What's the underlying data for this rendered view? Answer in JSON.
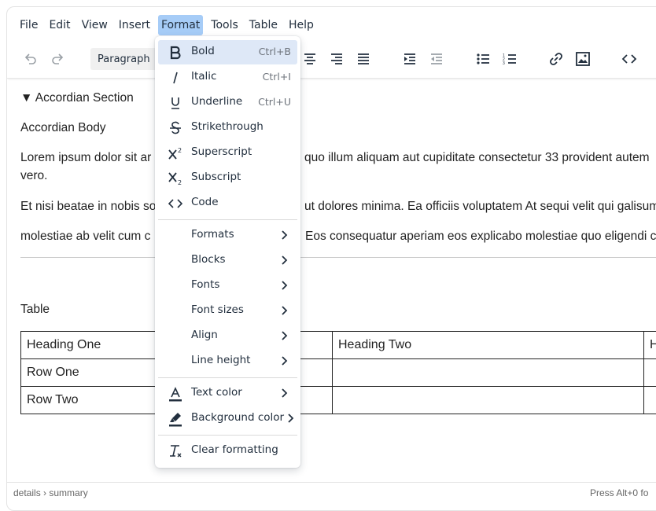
{
  "menubar": {
    "items": [
      "File",
      "Edit",
      "View",
      "Insert",
      "Format",
      "Tools",
      "Table",
      "Help"
    ],
    "active": "Format"
  },
  "toolbar": {
    "undo_icon": "undo-icon",
    "redo_icon": "redo-icon",
    "blocks_label": "Paragraph",
    "icons": [
      "align-center-icon",
      "align-right-icon",
      "align-justify-icon",
      "indent-icon",
      "outdent-icon",
      "bullet-list-icon",
      "numbered-list-icon",
      "link-icon",
      "image-icon",
      "source-code-icon"
    ]
  },
  "content": {
    "summary": "▼ Accordian Section",
    "body_title": "Accordian Body",
    "para1_left": "Lorem ipsum dolor sit ar",
    "para1_right": "quo illum aliquam aut cupiditate consectetur 33 provident autem",
    "para1_line2": "vero.",
    "para2_left": "Et nisi beatae in nobis so",
    "para2_right": "ut dolores minima. Ea officiis voluptatem At sequi velit qui galisum",
    "para3_left": " molestiae ab velit cum c",
    "para3_right": "Eos consequatur aperiam eos explicabo molestiae quo eligendi c",
    "table_caption": "Table",
    "table": {
      "rows": [
        [
          "Heading One",
          "",
          "Heading Two",
          "H"
        ],
        [
          "Row One",
          "",
          "",
          ""
        ],
        [
          "Row Two",
          "",
          "",
          ""
        ]
      ]
    }
  },
  "statusbar": {
    "path": "details › summary",
    "right": "Press Alt+0 fo"
  },
  "format_menu": {
    "items": [
      {
        "label": "Bold",
        "shortcut": "Ctrl+B",
        "icon": "bold-icon",
        "highlighted": true
      },
      {
        "label": "Italic",
        "shortcut": "Ctrl+I",
        "icon": "italic-icon"
      },
      {
        "label": "Underline",
        "shortcut": "Ctrl+U",
        "icon": "underline-icon"
      },
      {
        "label": "Strikethrough",
        "shortcut": "",
        "icon": "strikethrough-icon"
      },
      {
        "label": "Superscript",
        "shortcut": "",
        "icon": "superscript-icon"
      },
      {
        "label": "Subscript",
        "shortcut": "",
        "icon": "subscript-icon"
      },
      {
        "label": "Code",
        "shortcut": "",
        "icon": "code-icon"
      },
      {
        "label": "Formats",
        "submenu": true
      },
      {
        "label": "Blocks",
        "submenu": true
      },
      {
        "label": "Fonts",
        "submenu": true
      },
      {
        "label": "Font sizes",
        "submenu": true
      },
      {
        "label": "Align",
        "submenu": true
      },
      {
        "label": "Line height",
        "submenu": true
      },
      {
        "label": "Text color",
        "submenu": true,
        "icon": "text-color-icon"
      },
      {
        "label": "Background color",
        "submenu": true,
        "icon": "highlighter-icon"
      },
      {
        "label": "Clear formatting",
        "icon": "clear-formatting-icon"
      }
    ]
  },
  "colors": {
    "menu_active": "#a6ccf7",
    "item_highlight": "#dee8f7"
  }
}
